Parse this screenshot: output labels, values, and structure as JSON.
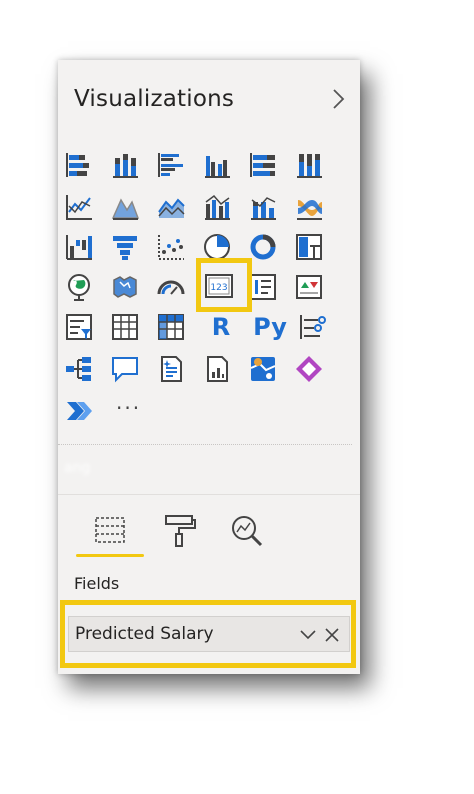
{
  "panel": {
    "title": "Visualizations",
    "collapse_icon": "chevron-right-icon"
  },
  "visuals": [
    "stacked-bar-chart-icon",
    "stacked-column-chart-icon",
    "clustered-bar-chart-icon",
    "clustered-column-chart-icon",
    "100-stacked-bar-chart-icon",
    "100-stacked-column-chart-icon",
    "line-chart-icon",
    "area-chart-icon",
    "stacked-area-chart-icon",
    "line-clustered-column-chart-icon",
    "line-stacked-column-chart-icon",
    "ribbon-chart-icon",
    "waterfall-chart-icon",
    "funnel-chart-icon",
    "scatter-chart-icon",
    "pie-chart-icon",
    "donut-chart-icon",
    "treemap-icon",
    "map-icon",
    "filled-map-icon",
    "gauge-icon",
    "card-icon",
    "multi-row-card-icon",
    "kpi-icon",
    "slicer-icon",
    "table-icon",
    "matrix-icon",
    "r-script-visual-icon",
    "python-visual-icon",
    "key-influencers-icon",
    "decomposition-tree-icon",
    "qa-icon",
    "smart-narrative-icon",
    "paginated-report-icon",
    "azure-map-icon",
    "power-apps-icon",
    "power-automate-icon"
  ],
  "letter_visuals": {
    "r": "R",
    "python": "Py"
  },
  "more_label": "···",
  "selected_visual": "card-icon",
  "pane_tabs": [
    "fields-tab-icon",
    "format-tab-icon",
    "analytics-tab-icon"
  ],
  "fields_section": {
    "label": "Fields",
    "field_name": "Predicted Salary"
  },
  "colors": {
    "highlight": "#f2c811",
    "accent_blue": "#1f6fd0",
    "panel_bg": "#f3f2f1"
  }
}
